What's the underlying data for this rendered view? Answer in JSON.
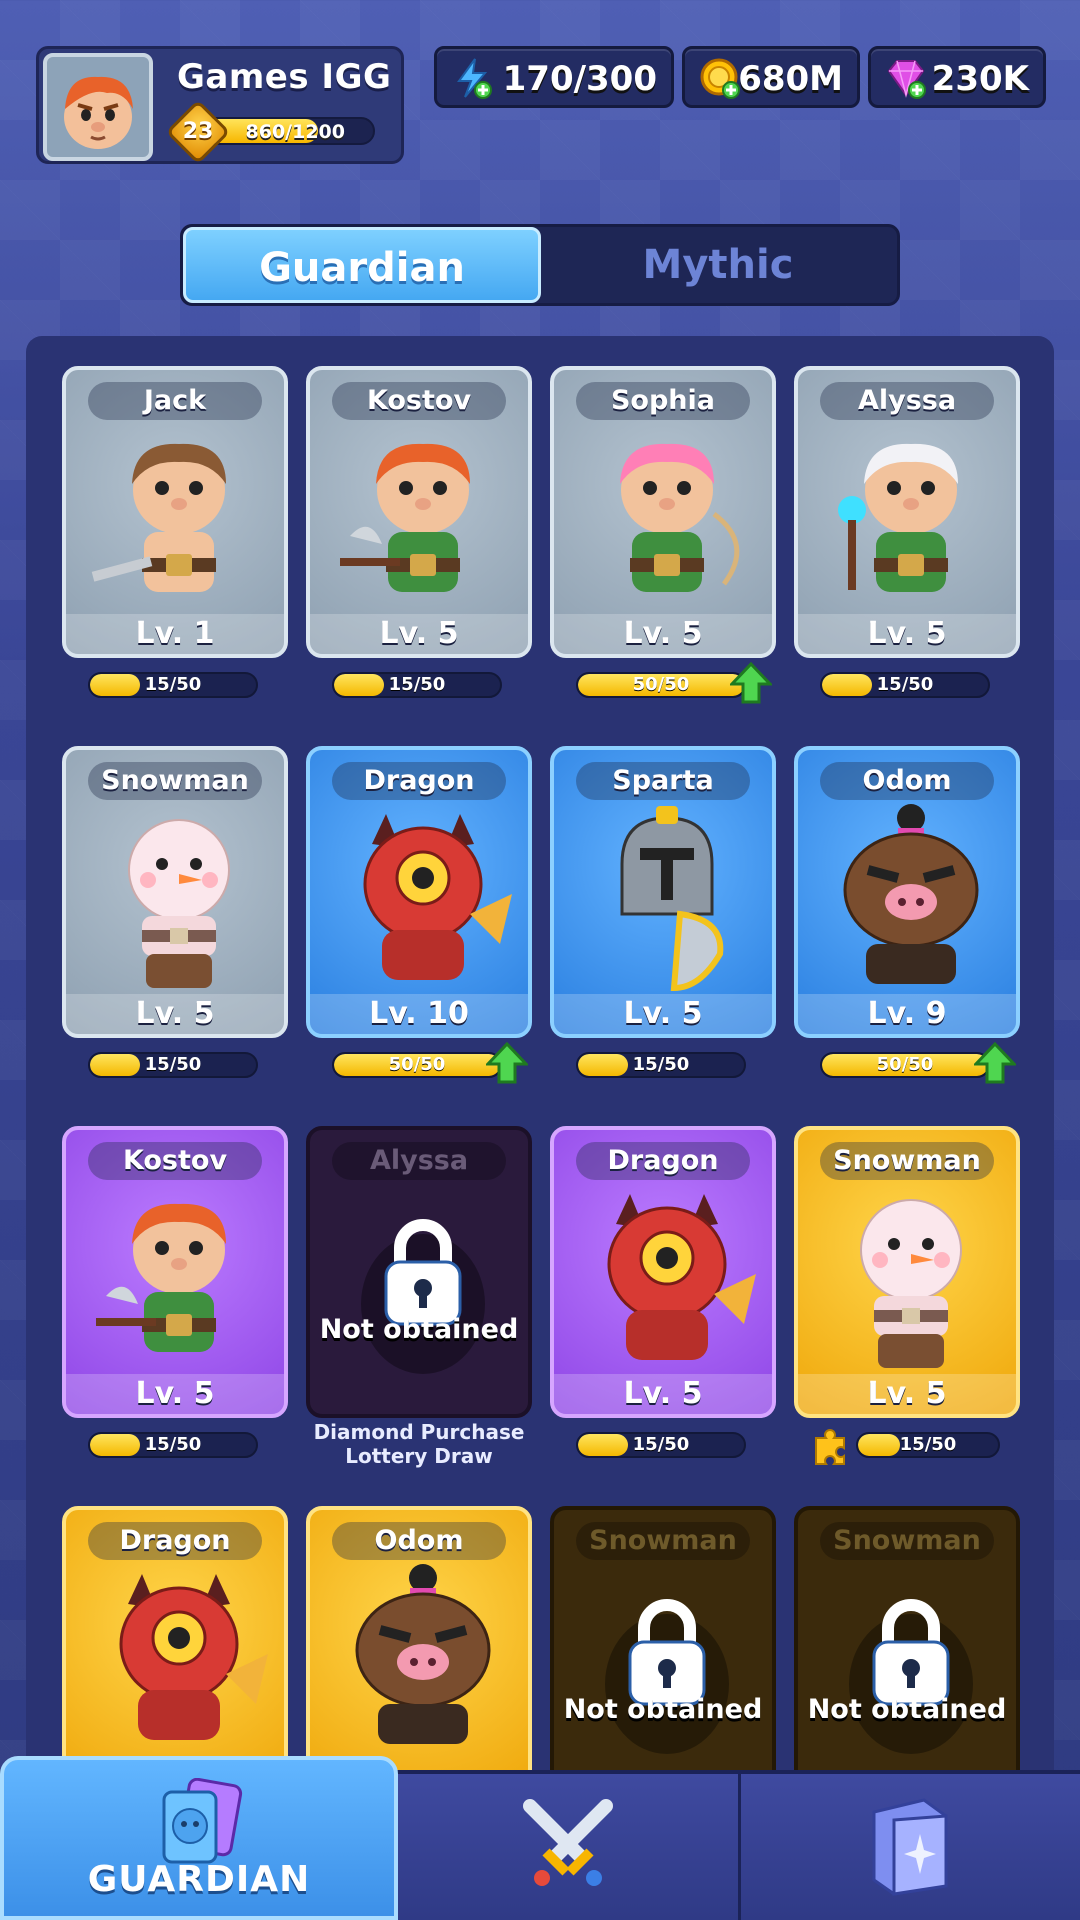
{
  "player": {
    "name": "Games IGG",
    "level": "23",
    "xp": "860/1200",
    "xp_fraction": 0.72
  },
  "resources": [
    {
      "icon": "energy-icon",
      "value": "170/300"
    },
    {
      "icon": "coin-icon",
      "value": "680M"
    },
    {
      "icon": "gem-icon",
      "value": "230K"
    }
  ],
  "tabs": [
    {
      "label": "Guardian",
      "active": true
    },
    {
      "label": "Mythic",
      "active": false
    }
  ],
  "cards": [
    {
      "name": "Jack",
      "level": "Lv. 1",
      "progress": "15/50",
      "fill": 0.3,
      "rarity": "grey",
      "upgrade": false
    },
    {
      "name": "Kostov",
      "level": "Lv. 5",
      "progress": "15/50",
      "fill": 0.3,
      "rarity": "grey",
      "upgrade": false
    },
    {
      "name": "Sophia",
      "level": "Lv. 5",
      "progress": "50/50",
      "fill": 1.0,
      "rarity": "grey",
      "upgrade": true
    },
    {
      "name": "Alyssa",
      "level": "Lv. 5",
      "progress": "15/50",
      "fill": 0.3,
      "rarity": "grey",
      "upgrade": false
    },
    {
      "name": "Snowman",
      "level": "Lv. 5",
      "progress": "15/50",
      "fill": 0.3,
      "rarity": "grey",
      "upgrade": false
    },
    {
      "name": "Dragon",
      "level": "Lv. 10",
      "progress": "50/50",
      "fill": 1.0,
      "rarity": "blue",
      "upgrade": true
    },
    {
      "name": "Sparta",
      "level": "Lv. 5",
      "progress": "15/50",
      "fill": 0.3,
      "rarity": "blue",
      "upgrade": false
    },
    {
      "name": "Odom",
      "level": "Lv. 9",
      "progress": "50/50",
      "fill": 1.0,
      "rarity": "blue",
      "upgrade": true
    },
    {
      "name": "Kostov",
      "level": "Lv. 5",
      "progress": "15/50",
      "fill": 0.3,
      "rarity": "purple",
      "upgrade": false
    },
    {
      "name": "Alyssa",
      "locked": true,
      "status": "Not obtained",
      "note_line1": "Diamond Purchase",
      "note_line2": "Lottery Draw",
      "rarity": "lockedpurple"
    },
    {
      "name": "Dragon",
      "level": "Lv. 5",
      "progress": "15/50",
      "fill": 0.3,
      "rarity": "purple",
      "upgrade": false
    },
    {
      "name": "Snowman",
      "level": "Lv. 5",
      "progress": "15/50",
      "fill": 0.3,
      "rarity": "gold",
      "upgrade": false,
      "puzzle": true
    },
    {
      "name": "Dragon",
      "rarity": "gold"
    },
    {
      "name": "Odom",
      "rarity": "gold"
    },
    {
      "name": "Snowman",
      "locked": true,
      "status": "Not obtained",
      "rarity": "lockedgold"
    },
    {
      "name": "Snowman",
      "locked": true,
      "status": "Not obtained",
      "rarity": "lockedgold"
    }
  ],
  "bottom_nav": [
    {
      "label": "GUARDIAN",
      "icon": "guardian-cards-icon",
      "active": true
    },
    {
      "label": "",
      "icon": "crossed-swords-icon",
      "active": false
    },
    {
      "label": "",
      "icon": "spellbook-icon",
      "active": false
    }
  ]
}
